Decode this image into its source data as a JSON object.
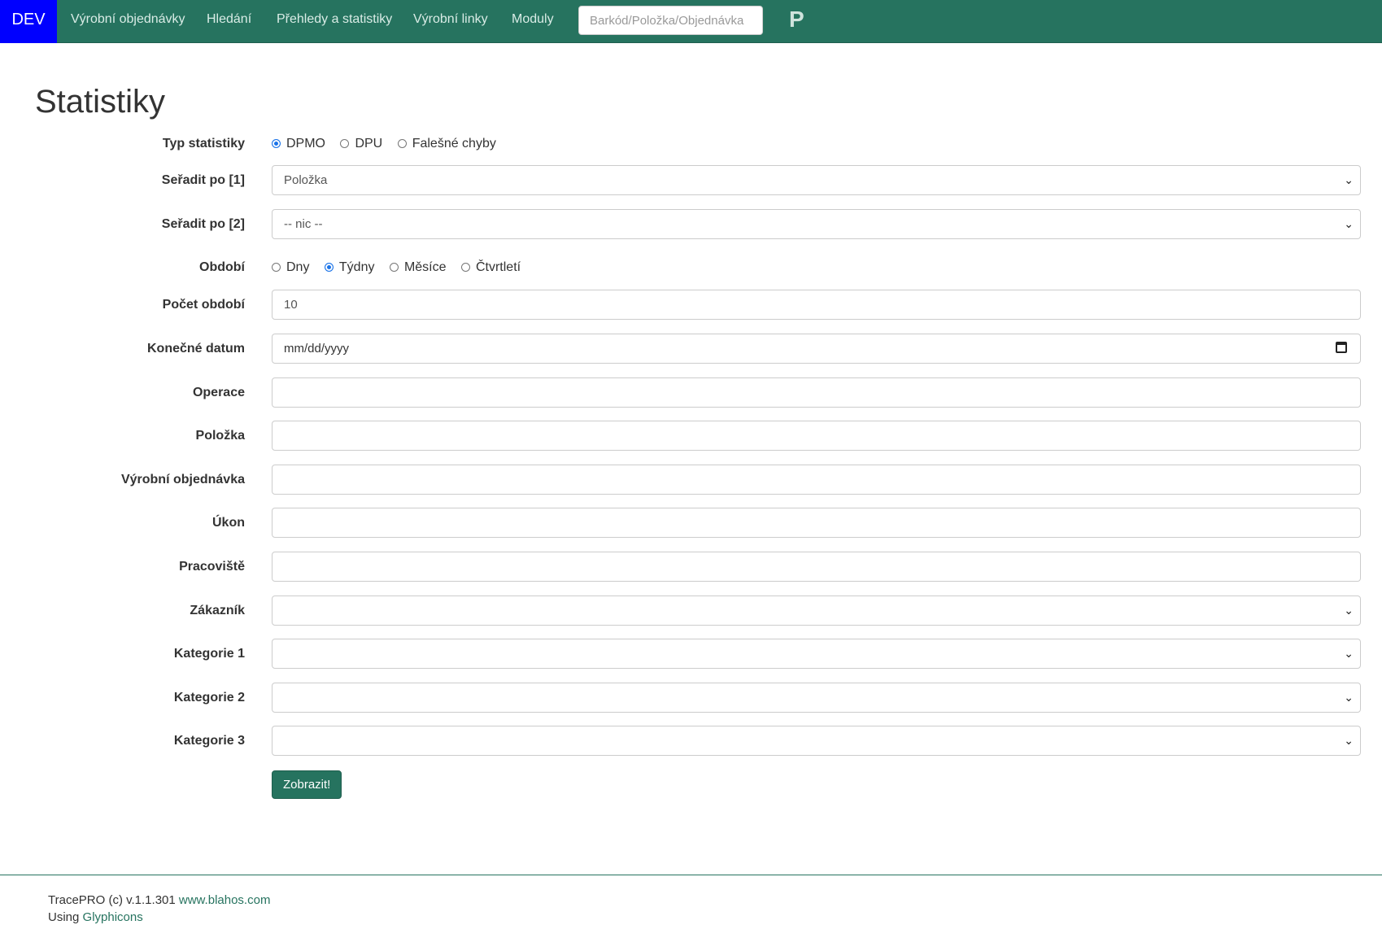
{
  "navbar": {
    "brand": "DEV",
    "items": [
      "Výrobní objednávky",
      "Hledání",
      "Přehledy a statistiky",
      "Výrobní linky",
      "Moduly"
    ],
    "search_placeholder": "Barkód/Položka/Objednávka",
    "extra": "P"
  },
  "page": {
    "title": "Statistiky"
  },
  "form": {
    "typ": {
      "label": "Typ statistiky",
      "options": [
        "DPMO",
        "DPU",
        "Falešné chyby"
      ],
      "selected": "DPMO"
    },
    "sort1": {
      "label": "Seřadit po [1]",
      "value": "Položka"
    },
    "sort2": {
      "label": "Seřadit po [2]",
      "value": "-- nic --"
    },
    "obdobi": {
      "label": "Období",
      "options": [
        "Dny",
        "Týdny",
        "Měsíce",
        "Čtvrtletí"
      ],
      "selected": "Týdny"
    },
    "pocet": {
      "label": "Počet období",
      "value": "10"
    },
    "datum": {
      "label": "Konečné datum",
      "placeholder": "mm/dd/yyyy"
    },
    "operace": {
      "label": "Operace",
      "value": ""
    },
    "polozka": {
      "label": "Položka",
      "value": ""
    },
    "objednavka": {
      "label": "Výrobní objednávka",
      "value": ""
    },
    "ukon": {
      "label": "Úkon",
      "value": ""
    },
    "pracoviste": {
      "label": "Pracoviště",
      "value": ""
    },
    "zakaznik": {
      "label": "Zákazník",
      "value": ""
    },
    "kat1": {
      "label": "Kategorie 1",
      "value": ""
    },
    "kat2": {
      "label": "Kategorie 2",
      "value": ""
    },
    "kat3": {
      "label": "Kategorie 3",
      "value": ""
    },
    "submit_label": "Zobrazit!"
  },
  "footer": {
    "copyright": "TracePRO (c) v.1.1.301",
    "site_link": "www.blahos.com",
    "using": "Using",
    "glyph_link": "Glyphicons"
  },
  "colors": {
    "navbar": "#26735f",
    "brand": "#0000ff",
    "radio_checked": "#1a73e8"
  }
}
